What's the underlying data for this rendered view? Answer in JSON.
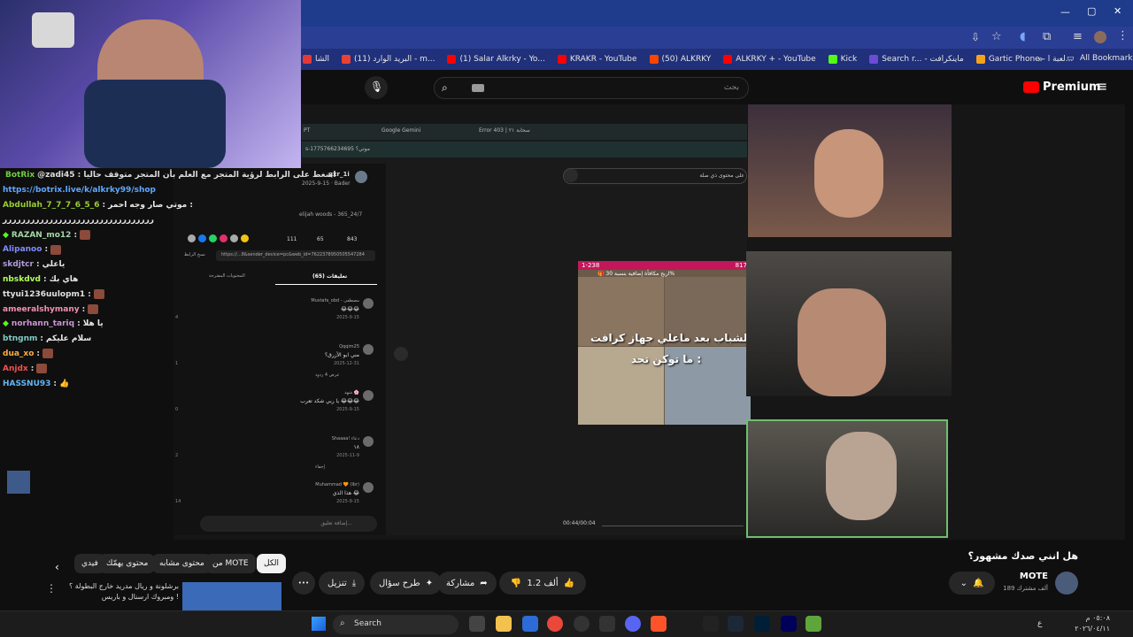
{
  "window": {
    "controls": {
      "minimize": "—",
      "maximize": "▢",
      "close": "✕"
    }
  },
  "bookmarks": [
    {
      "label": "الشا",
      "color": "#e53935"
    },
    {
      "label": "(11) البريد الوارد - m...",
      "color": "#e94235"
    },
    {
      "label": "(1) Salar Alkrky - Yo...",
      "color": "#ff0000"
    },
    {
      "label": "KRAKR - YouTube",
      "color": "#ff0000"
    },
    {
      "label": "(50) ALKRKY",
      "color": "#ff4500"
    },
    {
      "label": "ALKRKY + - YouTube",
      "color": "#ff0000"
    },
    {
      "label": "Kick",
      "color": "#53fc18"
    },
    {
      "label": "Search r... - ماينكرافت",
      "color": "#6c4bd6"
    },
    {
      "label": "Gartic Phone - لعبة ا...",
      "color": "#f3a31b"
    }
  ],
  "bookmarks_more": "»",
  "all_bookmarks": "All Bookmarks",
  "youtube": {
    "logo": "Premium",
    "search_placeholder": "بحث",
    "video_title": "هل انني صدك مشهور؟",
    "channel_name": "MOTE",
    "subscribers": "189 ألف مشترك",
    "likes": "1.2 ألف",
    "share": "مشاركة",
    "ask": "طرح سؤال",
    "download": "تنزيل",
    "more": "•••",
    "chips": [
      "الكل",
      "من MOTE",
      "محتوى مشابه",
      "محتوى يهمّك",
      "فيدي"
    ],
    "rec_title_1": "برشلونة و ريال مدريد خارج البطولة ؟",
    "rec_title_2": "ومبروك ارسنال و باريس !",
    "time": "00:44/00:04"
  },
  "inner_browser": {
    "tabs": [
      "PT",
      "Google Gemini",
      "Error 403 | سحابة ٢١"
    ],
    "url": "s-1775766234695 موتي؟ "
  },
  "inner_page": {
    "comments_tab": "تعليقات (65)",
    "related_tab": "المحتويات المقترحة",
    "copy_link": "نسخ الرابط",
    "share_url": "https://...8&sender_device=pc&web_id=7622378950505547284",
    "user": "qxr_1i",
    "date": "2025-9-15 · Bader",
    "counts": {
      "likes": "843",
      "comments": "65",
      "shares": "111"
    },
    "music": "elijah woods - 365_24/7",
    "comment_input": "إضافة تعليق...",
    "search_box": "على محتوى ذي صلة",
    "comments": [
      {
        "user": "Mustafa_obd - مصطفى",
        "text": "😂😂😂",
        "date": "2025-9-15",
        "likes": "4"
      },
      {
        "user": "Qqqim25",
        "text": "مني ابو الأزرق؟",
        "date": "2025-12-31",
        "likes": "1",
        "replies": "عرض 4 ردود"
      },
      {
        "user": "شهد 🌸",
        "text": "يا ربي شكد تعرب 😂😂😂",
        "date": "2025-9-15",
        "likes": "0"
      },
      {
        "user": "Shaaaa! دعاء",
        "text": "١٨",
        "date": "2025-11-9",
        "likes": "2",
        "replies": "إخفاء"
      },
      {
        "user": "Muhammad 🧡 (Ibr)",
        "text": "هذا الذي 😂",
        "date": "2025-9-15",
        "likes": "14"
      }
    ]
  },
  "overlay": {
    "tiktok_text_1": "الشباب بعد ماعلي جهاز كرافت",
    "tiktok_text_2": "ما توكن تحد :",
    "tiktok_top_left": "1-238",
    "tiktok_top_right": "817",
    "tiktok_banner": "🎁 اربح مكافأة إضافية بنسبة 30%"
  },
  "chat": {
    "pinned_user": "BotRix",
    "pinned_text": "@zadi45 : اضغط على الرابط لرؤية المتجر مع العلم بأن المتجر متوقف حاليا",
    "pinned_link": "https://botrix.live/k/alkrky99/shop",
    "messages": [
      {
        "user": "Abdullah_7_7_7_6_5_6",
        "color": "#9acd32",
        "text": "موتي صار وجه احمر :",
        "badge": false
      },
      {
        "user": "",
        "color": "#ffffff",
        "text": "ررررررررررررررررررررررررررررررررر",
        "badge": false
      },
      {
        "user": "RAZAN_mo12",
        "color": "#a5d6a7",
        "text": "",
        "badge": true,
        "emote": true
      },
      {
        "user": "Alipanoo",
        "color": "#7e8cff",
        "text": "",
        "badge": false,
        "emote": true
      },
      {
        "user": "skdjtcr",
        "color": "#b39ddb",
        "text": "ياعلي",
        "badge": false
      },
      {
        "user": "nbskdvd",
        "color": "#b2ff59",
        "text": "هاي بك",
        "badge": false
      },
      {
        "user": "ttyui1236uulopm1",
        "color": "#e0e0e0",
        "text": "",
        "badge": false,
        "emote": true
      },
      {
        "user": "ameeralshymany",
        "color": "#f48fb1",
        "text": "",
        "badge": false,
        "emote": true
      },
      {
        "user": "norhann_tariq",
        "color": "#ce93d8",
        "text": "يا هلا",
        "badge": true
      },
      {
        "user": "btngnm",
        "color": "#80cbc4",
        "text": "سلام عليكم",
        "badge": false
      },
      {
        "user": "dua_xo",
        "color": "#ffab40",
        "text": "",
        "badge": false,
        "emote": true
      },
      {
        "user": "Anjdx",
        "color": "#ef5350",
        "text": "",
        "badge": false,
        "emote": true
      },
      {
        "user": "HASSNU93",
        "color": "#64b5f6",
        "text": "👍",
        "badge": false
      }
    ]
  },
  "taskbar": {
    "search": "Search",
    "clock_time": "٠٥:٠٨ م",
    "clock_date": "٢٠٢٦/٠٤/١١",
    "lang": "ع"
  }
}
